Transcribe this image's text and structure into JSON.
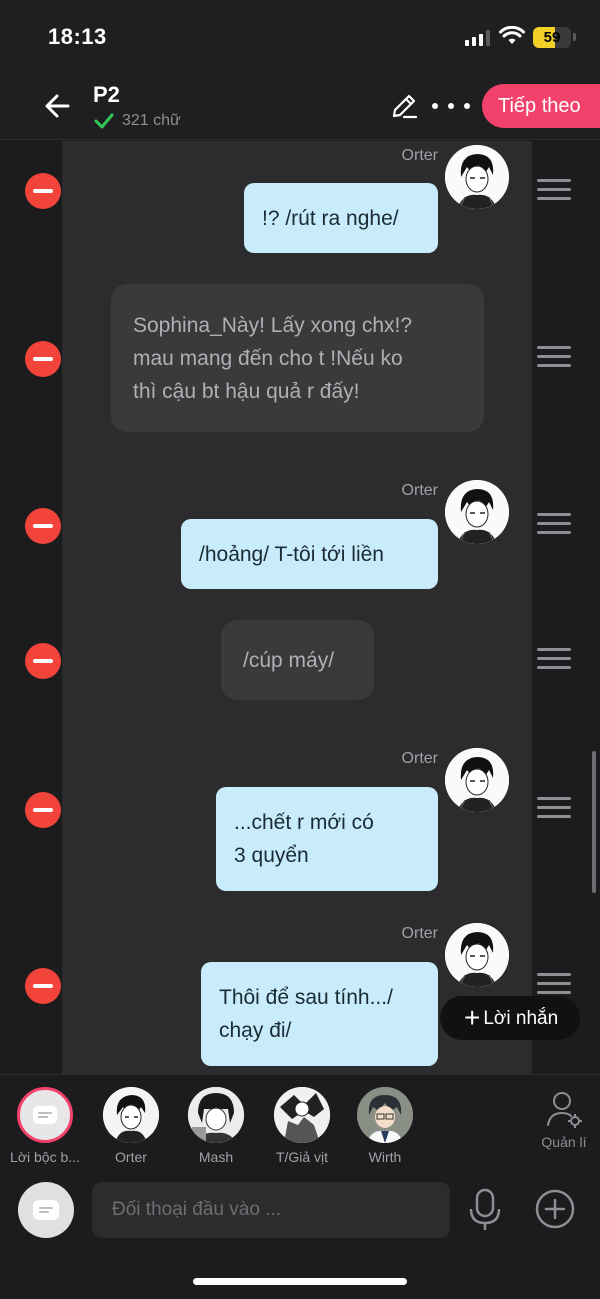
{
  "status_bar": {
    "time": "18:13",
    "battery": "59",
    "battery_level_percent": 59
  },
  "header": {
    "title": "P2",
    "word_count": "321 chữ",
    "next_label": "Tiếp theo"
  },
  "messages": [
    {
      "type": "character",
      "speaker": "Orter",
      "lines": [
        "!? /rút ra nghe/"
      ]
    },
    {
      "type": "narration",
      "lines": [
        "Sophina_Này! Lấy xong chx!?",
        "mau mang đến cho t !Nếu ko",
        "thì cậu bt hậu quả r đấy!"
      ]
    },
    {
      "type": "character",
      "speaker": "Orter",
      "lines": [
        "/hoảng/ T-tôi tới liền"
      ]
    },
    {
      "type": "narration",
      "lines": [
        "/cúp máy/"
      ]
    },
    {
      "type": "character",
      "speaker": "Orter",
      "lines": [
        "...chết r mới có",
        "3 quyển"
      ]
    },
    {
      "type": "character",
      "speaker": "Orter",
      "lines": [
        "Thôi để sau tính.../",
        "chạy đi/"
      ]
    }
  ],
  "add_line_label": "Lời nhắn",
  "characters": [
    {
      "label": "Lời bộc b...",
      "icon": "narration-icon",
      "selected": true
    },
    {
      "label": "Orter",
      "icon": "character-avatar"
    },
    {
      "label": "Mash",
      "icon": "character-avatar"
    },
    {
      "label": "T/Giả vịt",
      "icon": "character-avatar"
    },
    {
      "label": "Wirth",
      "icon": "character-avatar"
    }
  ],
  "manage_label": "Quản lí",
  "input": {
    "placeholder": "Đối thoại đầu vào ..."
  },
  "colors": {
    "accent": "#f2416b",
    "bubble": "#c8ecfb",
    "delete": "#f2443b",
    "panel": "#2c2c2e"
  }
}
